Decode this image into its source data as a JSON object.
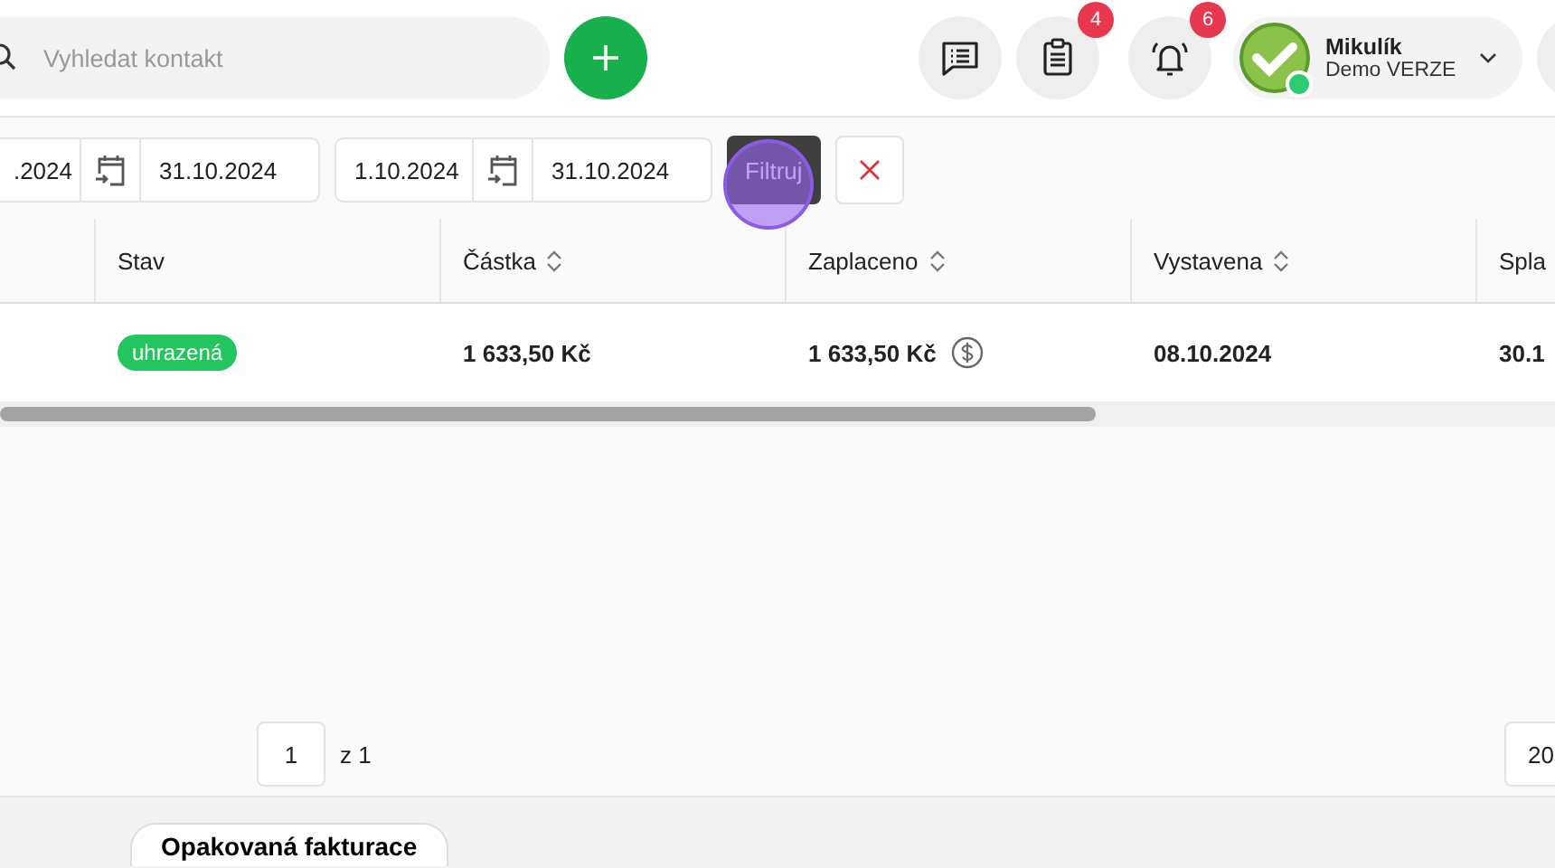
{
  "header": {
    "search": {
      "placeholder": "Vyhledat kontakt"
    },
    "badges": {
      "tasks": "4",
      "notifications": "6"
    },
    "user": {
      "name": "Mikulík",
      "subtitle": "Demo VERZE",
      "online": true
    }
  },
  "filters": {
    "ranges": [
      {
        "from": ".2024",
        "to": "31.10.2024"
      },
      {
        "from": "1.10.2024",
        "to": "31.10.2024"
      }
    ],
    "apply": "Filtruj"
  },
  "table": {
    "columns": [
      {
        "label": "Stav",
        "sortable": false
      },
      {
        "label": "Částka",
        "sortable": true
      },
      {
        "label": "Zaplaceno",
        "sortable": true
      },
      {
        "label": "Vystavena",
        "sortable": true
      },
      {
        "label": "Spla"
      }
    ],
    "rows": [
      {
        "status": "uhrazená",
        "color": "#22c55e",
        "amount": "1 633,50 Kč",
        "paid": "1 633,50 Kč",
        "issued": "08.10.2024",
        "due": "30.1"
      }
    ]
  },
  "pagination": {
    "page": "1",
    "of": "z 1",
    "page_size": "20"
  },
  "footer": {
    "button": "Opakovaná fakturace"
  }
}
